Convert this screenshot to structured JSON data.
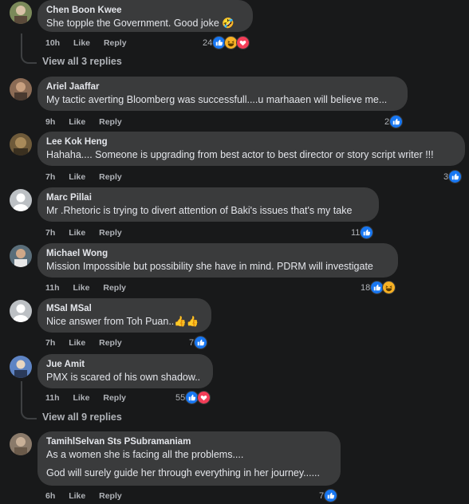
{
  "comments": [
    {
      "name": "Chen Boon Kwee",
      "text": "She topple the Government. Good joke 🤣",
      "time": "10h",
      "like": "Like",
      "reply": "Reply",
      "reactions": "24",
      "icons": [
        "like-icon",
        "haha-icon",
        "love-icon"
      ]
    },
    {
      "name": "Ariel Jaaffar",
      "text": "My tactic averting Bloomberg was successfull....u marhaaen will believe me...",
      "time": "9h",
      "like": "Like",
      "reply": "Reply",
      "reactions": "2",
      "icons": [
        "like-icon"
      ]
    },
    {
      "name": "Lee Kok Heng",
      "text": "Hahaha.... Someone is upgrading from best actor to best director or story script writer !!!",
      "time": "7h",
      "like": "Like",
      "reply": "Reply",
      "reactions": "3",
      "icons": [
        "like-icon"
      ]
    },
    {
      "name": "Marc Pillai",
      "text": "Mr .Rhetoric is trying to divert attention of Baki's issues that's my take",
      "time": "7h",
      "like": "Like",
      "reply": "Reply",
      "reactions": "11",
      "icons": [
        "like-icon"
      ]
    },
    {
      "name": "Michael Wong",
      "text": "Mission Impossible but possibility she have in mind. PDRM will investigate",
      "time": "11h",
      "like": "Like",
      "reply": "Reply",
      "reactions": "18",
      "icons": [
        "like-icon",
        "haha-icon"
      ]
    },
    {
      "name": "MSal MSal",
      "text": "Nice answer from Toh Puan..👍👍",
      "time": "7h",
      "like": "Like",
      "reply": "Reply",
      "reactions": "7",
      "icons": [
        "like-icon"
      ]
    },
    {
      "name": "Jue Amit",
      "text": "PMX is scared of his own shadow..",
      "time": "11h",
      "like": "Like",
      "reply": "Reply",
      "reactions": "55",
      "icons": [
        "like-icon",
        "love-icon"
      ]
    },
    {
      "name": "TamihlSelvan Sts PSubramaniam",
      "text": "As a women she is facing all the problems....",
      "text2": "God will surely guide her through everything in her journey......",
      "time": "6h",
      "like": "Like",
      "reply": "Reply",
      "reactions": "7",
      "icons": [
        "like-icon"
      ]
    }
  ],
  "view_replies_1": "View all 3 replies",
  "view_replies_2": "View all 9 replies",
  "colors": {
    "background": "#18191a",
    "bubble": "#3a3b3c",
    "like": "#1877f2",
    "love": "#f33e58",
    "haha": "#f7b125"
  }
}
